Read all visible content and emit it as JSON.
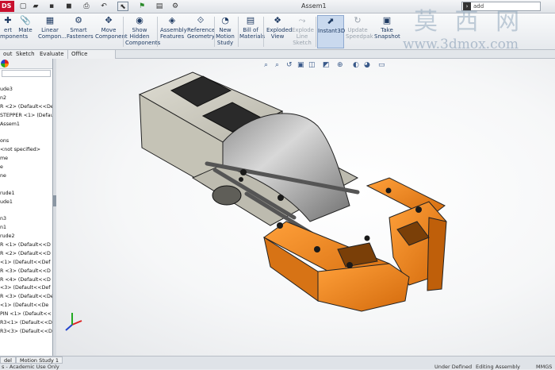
{
  "titlebar": {
    "logo": "DS",
    "doc_title": "Assem1",
    "search_value": "add",
    "quick_icons": [
      "new-icon",
      "open-icon",
      "save-icon",
      "print-icon",
      "undo-icon",
      "select-icon",
      "rebuild-icon",
      "options-icon"
    ]
  },
  "ribbon": {
    "buttons": [
      {
        "label": "Insert Components",
        "display": "ert\nmponents",
        "icon": "✚"
      },
      {
        "label": "Mate",
        "icon": "📎"
      },
      {
        "label": "Linear Component",
        "display": "Linear\nCompon...",
        "icon": "▦"
      },
      {
        "label": "Smart Fasteners",
        "display": "Smart\nFasteners",
        "icon": "⚙"
      },
      {
        "label": "Move Component",
        "display": "Move\nComponent",
        "icon": "✥"
      },
      {
        "label": "Show Hidden Components",
        "display": "Show\nHidden\nComponents",
        "icon": "◉"
      },
      {
        "label": "Assembly Features",
        "display": "Assembly\nFeatures",
        "icon": "◈"
      },
      {
        "label": "Reference Geometry",
        "display": "Reference\nGeometry",
        "icon": "⟐"
      },
      {
        "label": "New Motion Study",
        "display": "New\nMotion\nStudy",
        "icon": "◔"
      },
      {
        "label": "Bill of Materials",
        "display": "Bill of\nMaterials",
        "icon": "▤"
      },
      {
        "label": "Exploded View",
        "display": "Exploded\nView",
        "icon": "❖"
      },
      {
        "label": "Explode Line Sketch",
        "display": "Explode\nLine\nSketch",
        "icon": "⤳"
      },
      {
        "label": "Instant3D",
        "icon": "⬈"
      },
      {
        "label": "Update Speedpak",
        "display": "Update\nSpeedpak",
        "icon": "↻"
      },
      {
        "label": "Take Snapshot",
        "display": "Take\nSnapshot",
        "icon": "▣"
      }
    ]
  },
  "tabs": [
    "out",
    "Sketch",
    "Evaluate",
    "Office Products"
  ],
  "tree": [
    "ude3",
    "n2",
    "R <2> (Default<<De",
    "STEPPER <1> (Defau",
    "Assem1",
    "",
    "ons",
    "<not specified>",
    "me",
    "e",
    "ne",
    "",
    "rude1",
    "ude1",
    "",
    "n3",
    "n1",
    "rude2",
    "R <1> (Default<<D",
    "R <2> (Default<<D",
    "<1> (Default<<Def",
    "R <3> (Default<<D",
    "R <4> (Default<<D",
    "<3> (Default<<Def",
    "R <3> (Default<<De",
    "<1> (Default<<De",
    "PIN <1> (Default<<",
    "R3<1> (Default<<D",
    "R3<3> (Default<<D"
  ],
  "bottom_tabs": [
    "del",
    "Motion Study 1"
  ],
  "status": {
    "left": "s - Academic Use Only",
    "under_defined": "Under Defined",
    "editing": "Editing Assembly",
    "units": "MMGS"
  },
  "watermark": {
    "cn": "莫 西 网",
    "url": "www.3dmox.com"
  },
  "colors": {
    "model_grey": "#c9c8bd",
    "model_orange": "#f07e16",
    "ribbon_text": "#1f3b63",
    "active_button": "#c9d9ee"
  }
}
